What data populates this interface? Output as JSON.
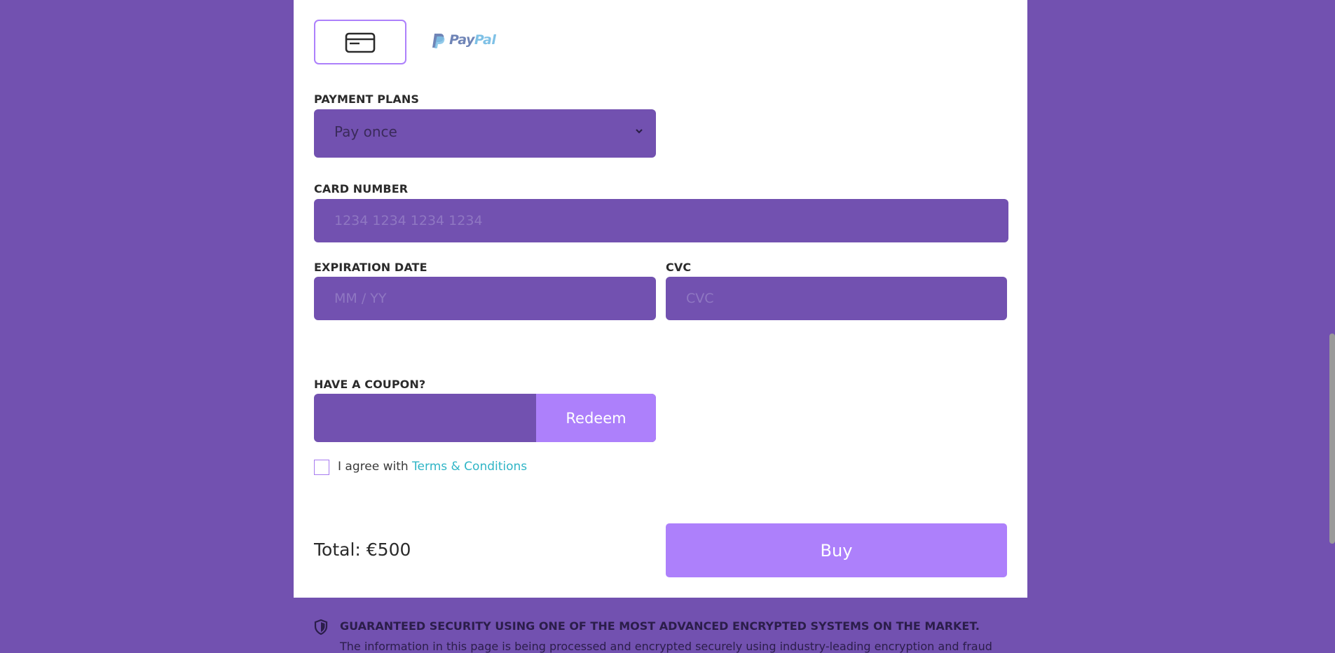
{
  "payment_methods": {
    "card_icon": "credit-card-icon",
    "paypal_logo": {
      "pay": "Pay",
      "pal": "Pal"
    }
  },
  "payment_plans": {
    "label": "PAYMENT PLANS",
    "selected": "Pay once"
  },
  "card_number": {
    "label": "CARD NUMBER",
    "placeholder": "1234 1234 1234 1234"
  },
  "expiration": {
    "label": "EXPIRATION DATE",
    "placeholder": "MM / YY"
  },
  "cvc": {
    "label": "CVC",
    "placeholder": "CVC"
  },
  "coupon": {
    "label": "HAVE A COUPON?",
    "button": "Redeem"
  },
  "agreement": {
    "prefix": "I agree with",
    "link": "Terms & Conditions"
  },
  "total": "Total: €500",
  "buy_button": "Buy",
  "security": {
    "icon": "shield-icon",
    "title": "GUARANTEED SECURITY USING ONE OF THE MOST ADVANCED ENCRYPTED SYSTEMS ON THE MARKET.",
    "text": "The information in this page is being processed and encrypted securely using industry-leading encryption and fraud"
  },
  "colors": {
    "background": "#7251b0",
    "accent": "#ad80fb",
    "link": "#2fb5c6",
    "card": "#ffffff"
  }
}
